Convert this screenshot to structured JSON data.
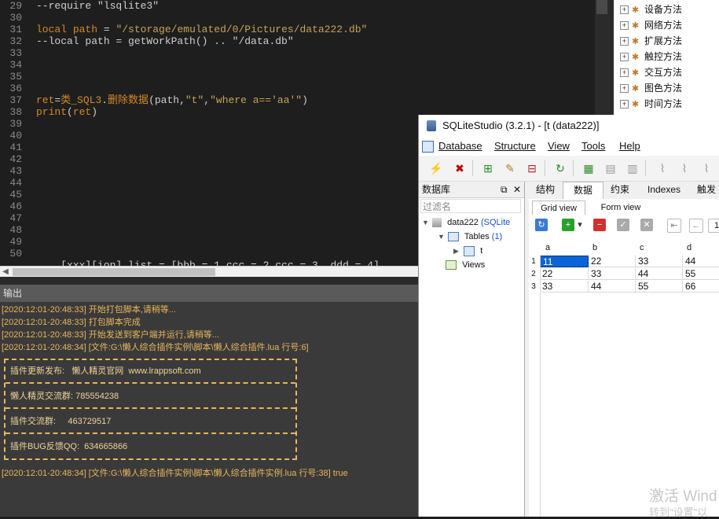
{
  "editor": {
    "line_numbers": [
      "29",
      "30",
      "31",
      "32",
      "33",
      "34",
      "35",
      "36",
      "37",
      "38",
      "39",
      "40",
      "41",
      "42",
      "43",
      "44",
      "45",
      "46",
      "47",
      "48",
      "49",
      "50"
    ],
    "code_lines": [
      {
        "text": "--require \"lsqlite3\"",
        "cls": "cmt"
      },
      {
        "text": "",
        "cls": ""
      },
      {
        "text": "local path = \"/storage/emulated/0/Pictures/data222.db\"",
        "cls": "mixed1"
      },
      {
        "text": "--local path = getWorkPath() .. \"/data.db\"",
        "cls": "cmt"
      },
      {
        "text": "",
        "cls": ""
      },
      {
        "text": "",
        "cls": ""
      },
      {
        "text": "",
        "cls": ""
      },
      {
        "text": "",
        "cls": ""
      },
      {
        "text": "ret=类_SQL3.删除数据(path,\"t\",\"where a=='aa'\")",
        "cls": "mixed2"
      },
      {
        "text": "print(ret)",
        "cls": "mixed3"
      }
    ],
    "partial_line": "    [xxx][ion] list = [bbb = 1,ccc = 2,ccc = 3, ddd = 4]"
  },
  "tree": {
    "items": [
      "设备方法",
      "网络方法",
      "扩展方法",
      "触控方法",
      "交互方法",
      "图色方法",
      "时间方法"
    ]
  },
  "output": {
    "header": "输出",
    "lines": [
      "[2020:12:01-20:48:33] 开始打包脚本,请稍等...",
      "[2020:12:01-20:48:33] 打包脚本完成",
      "[2020:12:01-20:48:33] 开始发送到客户端并运行,请稍等...",
      "[2020:12:01-20:48:34] [文件:G:\\懒人综合插件实例\\脚本\\懒人综合插件.lua 行号:6]"
    ],
    "box_rows": [
      "插件更新发布:   懒人精灵官网  www.lrappsoft.com",
      "懒人精灵交流群: 785554238",
      "插件交流群:     463729517",
      "插件BUG反馈QQ:  634665866"
    ],
    "final_line": "[2020:12:01-20:48:34] [文件:G:\\懒人综合插件实例\\脚本\\懒人综合插件实例.lua 行号:38] true"
  },
  "sqlite": {
    "title": "SQLiteStudio (3.2.1) - [t (data222)]",
    "menu": [
      "Database",
      "Structure",
      "View",
      "Tools",
      "Help"
    ],
    "db_panel": {
      "title": "数据库",
      "filter_placeholder": "过滤名",
      "db_name": "data222",
      "db_type": "(SQLite",
      "tables_label": "Tables",
      "tables_count": "(1)",
      "table_name": "t",
      "views_label": "Views"
    },
    "tabs": [
      "结构",
      "数据",
      "约束",
      "Indexes",
      "触发"
    ],
    "subtabs": [
      "Grid view",
      "Form view"
    ],
    "page_field": "1",
    "columns": [
      "a",
      "b",
      "c",
      "d"
    ],
    "rows": [
      {
        "num": "1",
        "cells": [
          "11",
          "22",
          "33",
          "44"
        ]
      },
      {
        "num": "2",
        "cells": [
          "22",
          "33",
          "44",
          "55"
        ]
      },
      {
        "num": "3",
        "cells": [
          "33",
          "44",
          "55",
          "66"
        ]
      }
    ]
  },
  "watermark": {
    "line1": "激活 Wind",
    "line2": "转到\"设置\"以"
  },
  "colors": {
    "accent": "#e8b65c",
    "selection": "#0a64d8"
  }
}
